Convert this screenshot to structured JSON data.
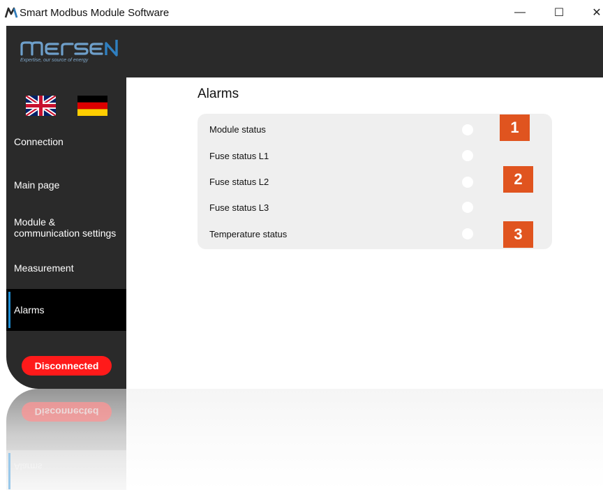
{
  "window": {
    "title": "Smart Modbus Module Software",
    "minimize": "—",
    "maximize": "☐",
    "close": "✕"
  },
  "brand": {
    "logo_text": "MERSEN",
    "tagline": "Expertise, our source of energy",
    "accent": "#2f7fc0"
  },
  "languages": [
    "English",
    "Deutsch"
  ],
  "sidebar": {
    "items": [
      {
        "label": "Connection"
      },
      {
        "label": "Main page"
      },
      {
        "label": "Module & communication settings"
      },
      {
        "label": "Measurement"
      },
      {
        "label": "Alarms",
        "active": true
      }
    ],
    "status_button": "Disconnected",
    "status_color": "#ff1a1a"
  },
  "main": {
    "title": "Alarms",
    "rows": [
      {
        "label": "Module status",
        "state": "off"
      },
      {
        "label": "Fuse status L1",
        "state": "off"
      },
      {
        "label": "Fuse status L2",
        "state": "off"
      },
      {
        "label": "Fuse status L3",
        "state": "off"
      },
      {
        "label": "Temperature status",
        "state": "off"
      }
    ],
    "badges": [
      "1",
      "2",
      "3"
    ],
    "badge_color": "#e0541f"
  }
}
